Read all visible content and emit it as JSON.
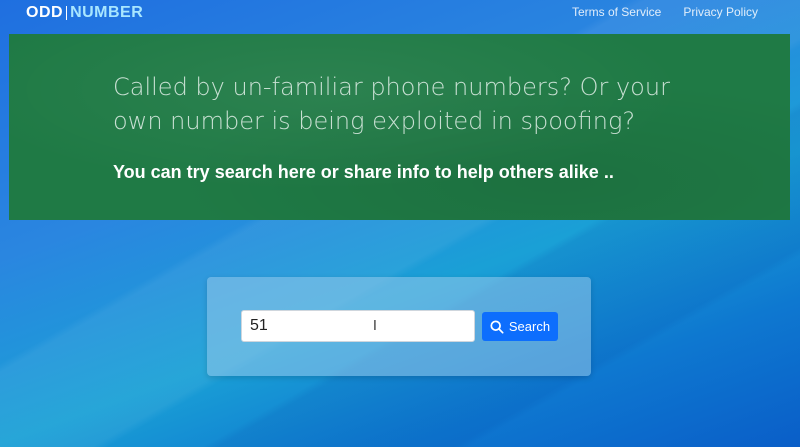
{
  "header": {
    "logo": {
      "part1": "ODD",
      "part2": "NUMBER"
    },
    "nav": [
      {
        "label": "Terms of Service"
      },
      {
        "label": "Privacy Policy"
      }
    ]
  },
  "hero": {
    "headline": "Called by un-familiar phone numbers? Or your own number is being exploited in spoofing?",
    "subline": "You can try search here or share info to help others alike .."
  },
  "search": {
    "value": "51",
    "button_label": "Search",
    "button_icon": "search-icon"
  },
  "colors": {
    "hero_bg": "#1f7a45",
    "button_bg": "#0d6efd",
    "logo_accent": "#a8e6ff"
  }
}
